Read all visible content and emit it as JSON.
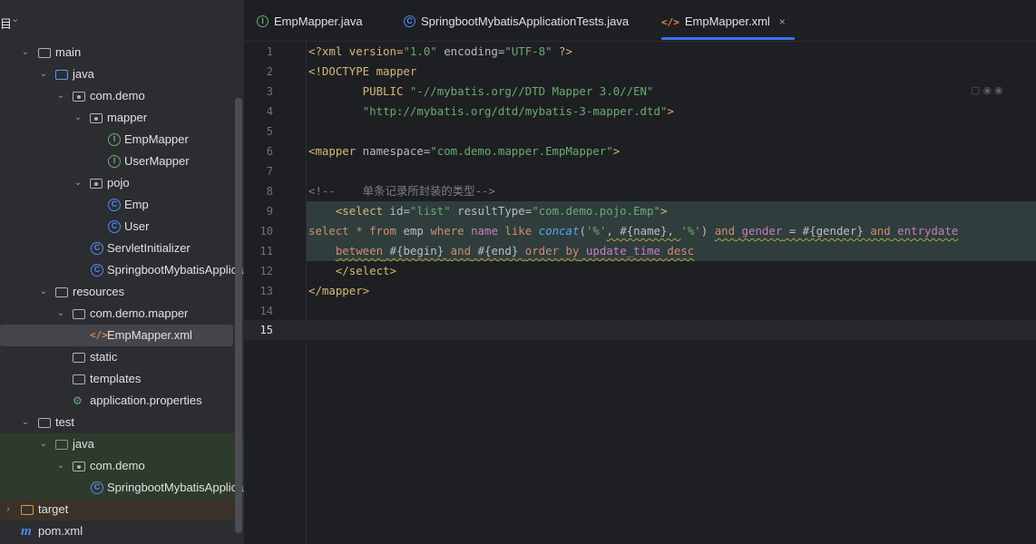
{
  "sidebar": {
    "project_label": "目",
    "items": [
      {
        "label": "main",
        "type": "folder"
      },
      {
        "label": "java",
        "type": "src-folder"
      },
      {
        "label": "com.demo",
        "type": "package"
      },
      {
        "label": "mapper",
        "type": "package"
      },
      {
        "label": "EmpMapper",
        "type": "interface",
        "badge": "I"
      },
      {
        "label": "UserMapper",
        "type": "interface",
        "badge": "I"
      },
      {
        "label": "pojo",
        "type": "package"
      },
      {
        "label": "Emp",
        "type": "class",
        "badge": "C"
      },
      {
        "label": "User",
        "type": "class",
        "badge": "C"
      },
      {
        "label": "ServletInitializer",
        "type": "class",
        "badge": "C"
      },
      {
        "label": "SpringbootMybatisApplica",
        "type": "spring-class",
        "badge": "C"
      },
      {
        "label": "resources",
        "type": "resources-folder"
      },
      {
        "label": "com.demo.mapper",
        "type": "package"
      },
      {
        "label": "EmpMapper.xml",
        "type": "xml",
        "badge": "</>"
      },
      {
        "label": "static",
        "type": "folder"
      },
      {
        "label": "templates",
        "type": "folder"
      },
      {
        "label": "application.properties",
        "type": "properties"
      },
      {
        "label": "test",
        "type": "folder"
      },
      {
        "label": "java",
        "type": "test-folder"
      },
      {
        "label": "com.demo",
        "type": "package"
      },
      {
        "label": "SpringbootMybatisApplica",
        "type": "spring-test-class",
        "badge": "C"
      },
      {
        "label": "target",
        "type": "excluded-folder"
      },
      {
        "label": "pom.xml",
        "type": "maven",
        "badge": "m"
      }
    ]
  },
  "tabs": [
    {
      "label": "EmpMapper.java",
      "icon": "interface-icon",
      "badge": "I"
    },
    {
      "label": "SpringbootMybatisApplicationTests.java",
      "icon": "test-class-icon",
      "badge": "C"
    },
    {
      "label": "EmpMapper.xml",
      "icon": "xml-icon",
      "badge": "</>",
      "active": true,
      "close": "×"
    }
  ],
  "editor": {
    "line_numbers": [
      "1",
      "2",
      "3",
      "4",
      "5",
      "6",
      "7",
      "8",
      "9",
      "10",
      "11",
      "12",
      "13",
      "14",
      "15"
    ],
    "current_line": "15",
    "code": {
      "l1_a": "<?xml version=",
      "l1_b": "\"1.0\"",
      "l1_c": " encoding=",
      "l1_d": "\"UTF-8\"",
      "l1_e": " ?>",
      "l2_a": "<!DOCTYPE mapper",
      "l3_a": "        PUBLIC ",
      "l3_b": "\"-//mybatis.org//DTD Mapper 3.0//EN\"",
      "l4_a": "        ",
      "l4_b": "\"http://mybatis.org/dtd/mybatis-3-mapper.dtd\"",
      "l4_c": ">",
      "l6_a": "<mapper",
      "l6_b": " namespace=",
      "l6_c": "\"com.demo.mapper.EmpMapper\"",
      "l6_d": ">",
      "l8_a": "<!--    单条记录所封装的类型-->",
      "l9_a": "    <select",
      "l9_b": " id=",
      "l9_c": "\"list\"",
      "l9_d": " resultType=",
      "l9_e": "\"com.demo.pojo.Emp\"",
      "l9_f": ">",
      "l10_select": "select",
      "l10_star": " * ",
      "l10_from": "from",
      "l10_emp": " emp ",
      "l10_where": "where",
      "l10_name": " name ",
      "l10_like": "like",
      "l10_concat": " concat",
      "l10_p1": "(",
      "l10_s1": "'%'",
      "l10_c1": ", #{name}, ",
      "l10_s2": "'%'",
      "l10_p2": ") ",
      "l10_and1": "and",
      "l10_gender": " gender",
      "l10_eq": " = #{gender} ",
      "l10_and2": "and",
      "l10_entry": " entrydate",
      "l11_ind": "    ",
      "l11_between": "between",
      "l11_b1": " #{begin} ",
      "l11_and": "and",
      "l11_b2": " #{end} ",
      "l11_order": "order by",
      "l11_ut": " update_time ",
      "l11_desc": "desc",
      "l12_a": "    </select",
      "l12_b": ">",
      "l13_a": "</mapper",
      "l13_b": ">"
    }
  }
}
